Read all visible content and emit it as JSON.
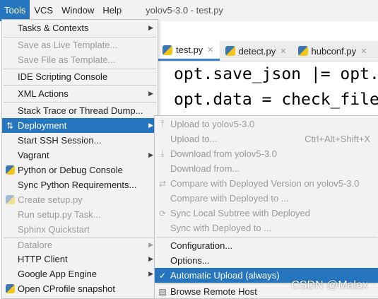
{
  "menubar": {
    "items": [
      "Tools",
      "VCS",
      "Window",
      "Help"
    ],
    "title": "yolov5-3.0 - test.py"
  },
  "editor": {
    "tabs": [
      {
        "label": "test.py",
        "close": "✕"
      },
      {
        "label": "detect.py",
        "close": "✕"
      },
      {
        "label": "hubconf.py",
        "close": "✕"
      }
    ],
    "code": [
      "opt.save_json |= opt.",
      "opt.data = check_file"
    ]
  },
  "tools_menu": {
    "items": [
      {
        "label": "Tasks & Contexts",
        "submenu": true
      },
      {
        "label": "Save as Live Template...",
        "disabled": true
      },
      {
        "label": "Save File as Template...",
        "disabled": true
      },
      {
        "label": "IDE Scripting Console"
      },
      {
        "label": "XML Actions",
        "submenu": true
      },
      {
        "label": "Stack Trace or Thread Dump..."
      },
      {
        "label": "Deployment",
        "submenu": true,
        "highlighted": true,
        "icon": "deployment-icon"
      },
      {
        "label": "Start SSH Session..."
      },
      {
        "label": "Vagrant",
        "submenu": true
      },
      {
        "label": "Python or Debug Console",
        "icon": "python-icon"
      },
      {
        "label": "Sync Python Requirements..."
      },
      {
        "label": "Create setup.py",
        "disabled": true,
        "icon": "python-icon"
      },
      {
        "label": "Run setup.py Task...",
        "disabled": true
      },
      {
        "label": "Sphinx Quickstart",
        "disabled": true
      },
      {
        "label": "Datalore",
        "disabled": true,
        "submenu": true
      },
      {
        "label": "HTTP Client",
        "submenu": true
      },
      {
        "label": "Google App Engine",
        "submenu": true
      },
      {
        "label": "Open CProfile snapshot",
        "icon": "cprofile-icon"
      }
    ]
  },
  "deployment_menu": {
    "items": [
      {
        "label": "Upload to yolov5-3.0",
        "disabled": true,
        "icon": "upload-icon"
      },
      {
        "label": "Upload to...",
        "disabled": true,
        "shortcut": "Ctrl+Alt+Shift+X"
      },
      {
        "label": "Download from yolov5-3.0",
        "disabled": true,
        "icon": "download-icon"
      },
      {
        "label": "Download from...",
        "disabled": true
      },
      {
        "label": "Compare with Deployed Version on yolov5-3.0",
        "disabled": true,
        "icon": "compare-icon"
      },
      {
        "label": "Compare with Deployed to ...",
        "disabled": true
      },
      {
        "label": "Sync Local Subtree with Deployed",
        "disabled": true,
        "icon": "sync-icon"
      },
      {
        "label": "Sync with Deployed to ...",
        "disabled": true
      },
      {
        "label": "Configuration..."
      },
      {
        "label": "Options..."
      },
      {
        "label": "Automatic Upload (always)",
        "highlighted": true,
        "checked": true,
        "icon": "checkmark-icon"
      },
      {
        "label": "Browse Remote Host",
        "icon": "browse-remote-icon"
      }
    ]
  },
  "icons": {
    "submenu_arrow": "▶",
    "check": "✓",
    "upload": "⤒",
    "download": "⤓",
    "compare": "⇄",
    "sync": "⟳",
    "deployment": "⇅",
    "browse": "▤"
  },
  "watermark": "CSDN @Malax",
  "colors": {
    "highlight": "#2675bf",
    "menu_bg": "#f2f2f2",
    "disabled_text": "#9a9a9a"
  }
}
